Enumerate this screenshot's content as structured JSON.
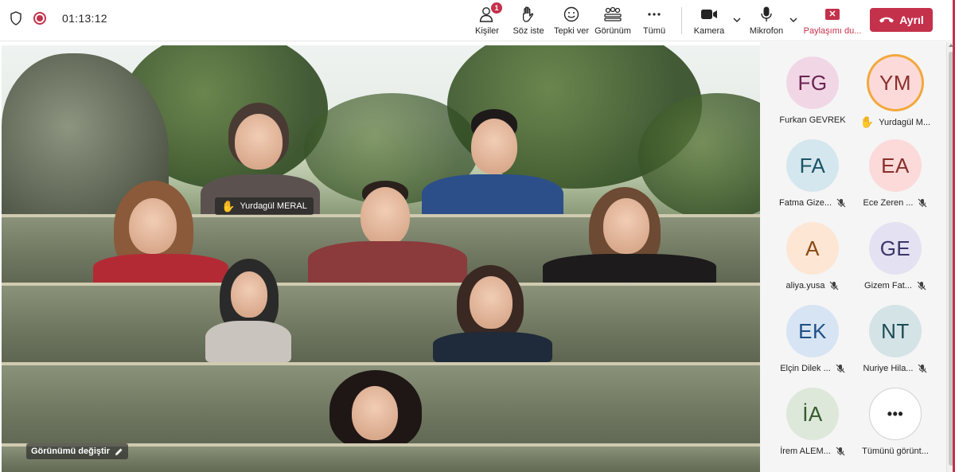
{
  "status": {
    "timer": "01:13:12"
  },
  "toolbar": {
    "people": {
      "label": "Kişiler",
      "badge": "1",
      "icon": "people-icon"
    },
    "raise_hand": {
      "label": "Söz iste",
      "icon": "hand-icon"
    },
    "react": {
      "label": "Tepki ver",
      "icon": "smiley-icon"
    },
    "view": {
      "label": "Görünüm",
      "icon": "view-icon"
    },
    "more": {
      "label": "Tümü",
      "icon": "more-icon"
    },
    "camera": {
      "label": "Kamera",
      "icon": "camera-icon"
    },
    "mic": {
      "label": "Mikrofon",
      "icon": "microphone-icon"
    },
    "share": {
      "label": "Paylaşımı du...",
      "icon": "stop-share-icon"
    },
    "leave": {
      "label": "Ayrıl",
      "icon": "phone-hangup-icon"
    }
  },
  "stage": {
    "name_tag": "Yurdagül MERAL",
    "change_view": "Görünümü değiştir"
  },
  "participants": [
    {
      "initials": "FG",
      "name": "Furkan GEVREK",
      "bg": "#f1d7e6",
      "fg": "#6b2450",
      "muted": false,
      "hand": false,
      "speaking": false
    },
    {
      "initials": "YM",
      "name": "Yurdagül M...",
      "bg": "#fbdad9",
      "fg": "#8a2f2c",
      "muted": false,
      "hand": true,
      "speaking": true
    },
    {
      "initials": "FA",
      "name": "Fatma Gize...",
      "bg": "#d5e7ee",
      "fg": "#1b5466",
      "muted": true,
      "hand": false,
      "speaking": false
    },
    {
      "initials": "EA",
      "name": "Ece Zeren ...",
      "bg": "#fbdad9",
      "fg": "#8a2f2c",
      "muted": true,
      "hand": false,
      "speaking": false
    },
    {
      "initials": "A",
      "name": "aliya.yusa",
      "bg": "#fde6d3",
      "fg": "#8a4a14",
      "muted": true,
      "hand": false,
      "speaking": false
    },
    {
      "initials": "GE",
      "name": "Gizem Fat...",
      "bg": "#e4e1f2",
      "fg": "#3c3669",
      "muted": true,
      "hand": false,
      "speaking": false
    },
    {
      "initials": "EK",
      "name": "Elçin Dilek ...",
      "bg": "#d6e4f3",
      "fg": "#1f4f86",
      "muted": true,
      "hand": false,
      "speaking": false
    },
    {
      "initials": "NT",
      "name": "Nuriye Hila...",
      "bg": "#d4e3e6",
      "fg": "#1c4c55",
      "muted": true,
      "hand": false,
      "speaking": false
    },
    {
      "initials": "İA",
      "name": "İrem ALEM...",
      "bg": "#dde8da",
      "fg": "#355a2c",
      "muted": true,
      "hand": false,
      "speaking": false
    },
    {
      "initials": "•••",
      "name": "Tümünü görünt...",
      "bg": "#ffffff",
      "fg": "#242424",
      "muted": false,
      "hand": false,
      "speaking": false
    }
  ],
  "colors": {
    "accent_red": "#c4314b",
    "hand_yellow": "#f2a83b"
  }
}
